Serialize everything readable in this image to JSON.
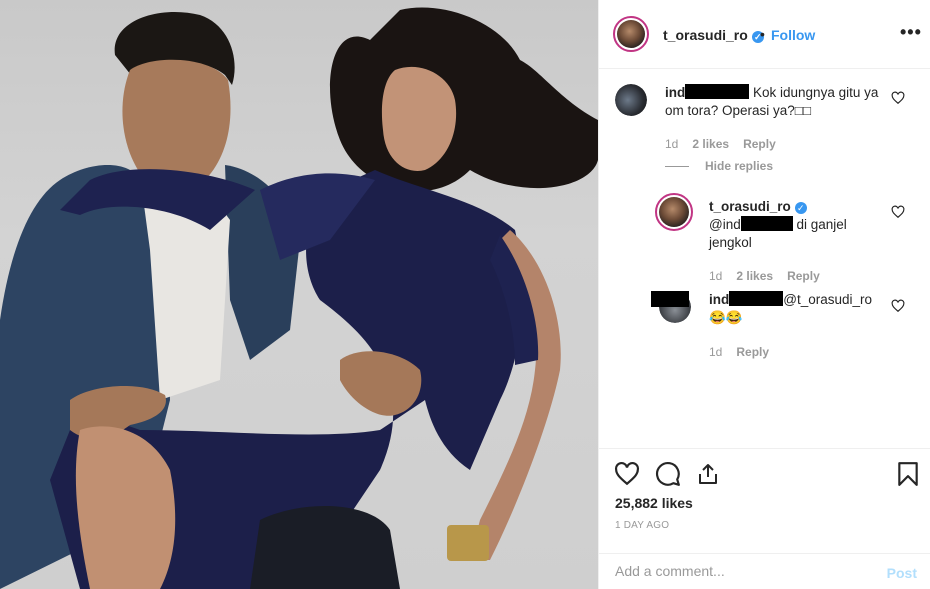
{
  "header": {
    "username": "t_orasudi_ro",
    "separator": "•",
    "follow_label": "Follow",
    "more_label": "•••"
  },
  "comments": [
    {
      "username_prefix": "ind",
      "text": "Kok idungnya gitu ya om tora? Operasi ya?□□",
      "time": "1d",
      "likes": "2 likes",
      "reply": "Reply",
      "hide_replies": "Hide replies"
    },
    {
      "username": "t_orasudi_ro",
      "mention_prefix": "@ind",
      "text": "di ganjel jengkol",
      "time": "1d",
      "likes": "2 likes",
      "reply": "Reply"
    },
    {
      "username_prefix": "ind",
      "mention": "@t_orasudi_ro",
      "text": "😂😂",
      "time": "1d",
      "reply": "Reply"
    }
  ],
  "actions": {
    "likes": "25,882 likes",
    "time_ago": "1 DAY AGO",
    "comment_placeholder": "Add a comment...",
    "post_label": "Post"
  },
  "icons": [
    "more-icon",
    "verified-icon",
    "heart-icon",
    "comment-icon",
    "share-icon",
    "bookmark-icon"
  ],
  "colors": {
    "link": "#3897f0",
    "story_ring": "#c13584",
    "muted": "#999999",
    "post_disabled": "#b2dffc"
  }
}
